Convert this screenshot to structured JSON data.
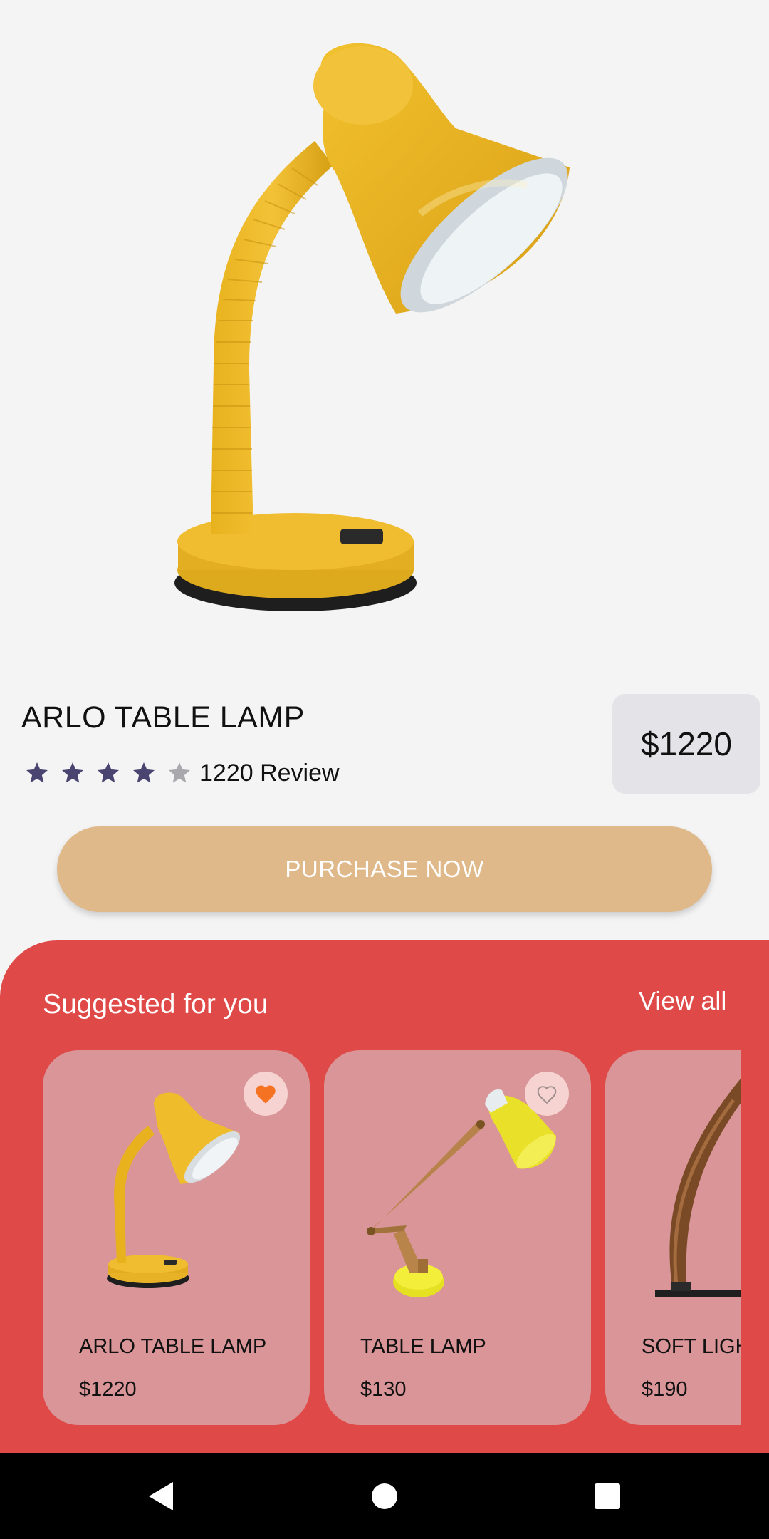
{
  "product": {
    "title": "ARLO TABLE LAMP",
    "rating": 4,
    "rating_max": 5,
    "review_text": "1220 Review",
    "price": "$1220"
  },
  "actions": {
    "purchase_label": "PURCHASE NOW"
  },
  "suggestions": {
    "heading": "Suggested for you",
    "view_all": "View all",
    "items": [
      {
        "name": "ARLO TABLE LAMP",
        "price": "$1220",
        "favorited": true,
        "image": "yellow-desk-lamp"
      },
      {
        "name": "TABLE LAMP",
        "price": "$130",
        "favorited": false,
        "image": "wooden-arm-lamp"
      },
      {
        "name": "SOFT LIGHT",
        "price": "$190",
        "favorited": false,
        "image": "curved-wood-floor-lamp"
      }
    ]
  },
  "nav": {
    "back": "back-icon",
    "home": "home-icon",
    "recents": "recents-icon"
  },
  "colors": {
    "background": "#f4f4f4",
    "price_box": "#e4e4e8",
    "purchase_button": "#e0b98a",
    "section": "#df4a48",
    "card": "#d99597",
    "star_filled": "#4a4470",
    "star_empty": "#a9a9ad",
    "heart_active": "#f57222",
    "fav_bg": "#f6d3d0"
  }
}
